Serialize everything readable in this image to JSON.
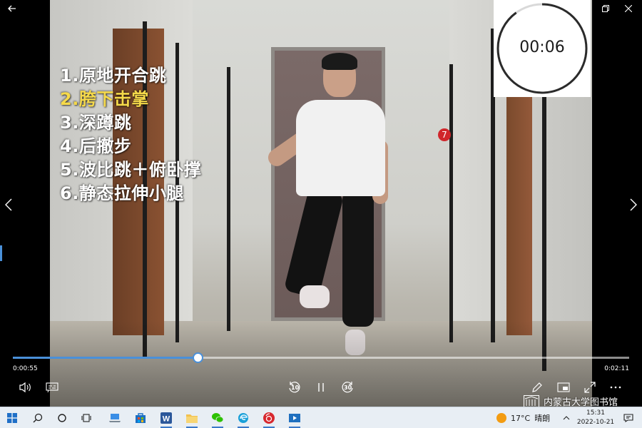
{
  "exercises": {
    "items": [
      {
        "label": "1.原地开合跳",
        "color": "#ffffff"
      },
      {
        "label": "2.胯下击掌",
        "color": "#f5d94a"
      },
      {
        "label": "3.深蹲跳",
        "color": "#ffffff"
      },
      {
        "label": "4.后撤步",
        "color": "#ffffff"
      },
      {
        "label": "5.波比跳＋俯卧撑",
        "color": "#ffffff"
      },
      {
        "label": "6.静态拉伸小腿",
        "color": "#ffffff"
      }
    ]
  },
  "timer": {
    "display": "00:06",
    "ring_color": "#2b2b2b",
    "ring_progress": 0.9
  },
  "player": {
    "time_current": "0:00:55",
    "time_total": "0:02:11",
    "progress": 0.3,
    "accent_color": "#4a90d9",
    "rewind_seconds": "10",
    "forward_seconds": "30"
  },
  "watermark": {
    "text": "内蒙古大学图书馆"
  },
  "taskbar": {
    "weather_temp": "17°C",
    "weather_desc": "晴朗",
    "clock_time": "15:31",
    "clock_date": "2022-10-21",
    "apps": [
      {
        "name": "start-button",
        "icon": "windows-logo-icon"
      },
      {
        "name": "search-button",
        "icon": "search-icon"
      },
      {
        "name": "cortana-button",
        "icon": "circle-icon"
      },
      {
        "name": "task-view-button",
        "icon": "task-view-icon"
      },
      {
        "name": "taskbar-app-laptop",
        "icon": "laptop-icon"
      },
      {
        "name": "taskbar-app-store",
        "icon": "store-icon"
      },
      {
        "name": "taskbar-app-word",
        "icon": "word-icon"
      },
      {
        "name": "taskbar-app-file-explorer",
        "icon": "folder-icon"
      },
      {
        "name": "taskbar-app-wechat",
        "icon": "wechat-icon"
      },
      {
        "name": "taskbar-app-edge",
        "icon": "edge-icon"
      },
      {
        "name": "taskbar-app-netease",
        "icon": "netease-music-icon"
      },
      {
        "name": "taskbar-app-media-player",
        "icon": "film-icon"
      }
    ]
  }
}
